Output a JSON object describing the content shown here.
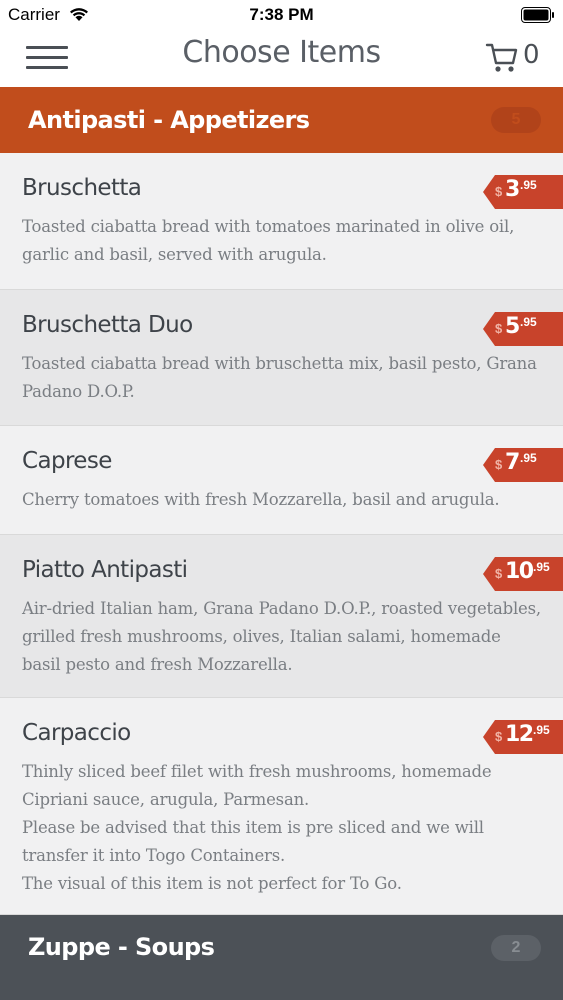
{
  "status": {
    "carrier": "Carrier",
    "time": "7:38 PM"
  },
  "nav": {
    "title": "Choose Items",
    "cart_count": "0"
  },
  "sections": [
    {
      "title": "Antipasti - Appetizers",
      "count": "5"
    },
    {
      "title": "Zuppe - Soups",
      "count": "2"
    }
  ],
  "items": [
    {
      "name": "Bruschetta",
      "desc": "Toasted ciabatta bread with tomatoes marinated in olive oil, garlic and basil, served with arugula.",
      "currency": "$",
      "dollars": "3",
      "cents": ".95"
    },
    {
      "name": "Bruschetta Duo",
      "desc": "Toasted ciabatta bread with bruschetta mix, basil pesto, Grana Padano D.O.P.",
      "currency": "$",
      "dollars": "5",
      "cents": ".95"
    },
    {
      "name": "Caprese",
      "desc": "Cherry tomatoes with fresh Mozzarella, basil and arugula.",
      "currency": "$",
      "dollars": "7",
      "cents": ".95"
    },
    {
      "name": "Piatto Antipasti",
      "desc": "Air-dried Italian ham, Grana Padano D.O.P., roasted vegetables, grilled fresh mushrooms, olives, Italian salami, homemade basil pesto and fresh Mozzarella.",
      "currency": "$",
      "dollars": "10",
      "cents": ".95"
    },
    {
      "name": "Carpaccio",
      "desc": "Thinly sliced beef filet with fresh mushrooms, homemade Cipriani sauce, arugula, Parmesan.\nPlease be advised that this item is pre sliced and we will transfer it into Togo Containers.\nThe visual of this item is not perfect for To Go.",
      "currency": "$",
      "dollars": "12",
      "cents": ".95"
    }
  ],
  "colors": {
    "accent": "#c14d1c",
    "price_tag": "#c8432b",
    "section_dark": "#4c5157"
  },
  "icons": {
    "menu": "hamburger-menu-icon",
    "cart": "shopping-cart-icon",
    "wifi": "wifi-icon",
    "battery": "battery-icon"
  }
}
